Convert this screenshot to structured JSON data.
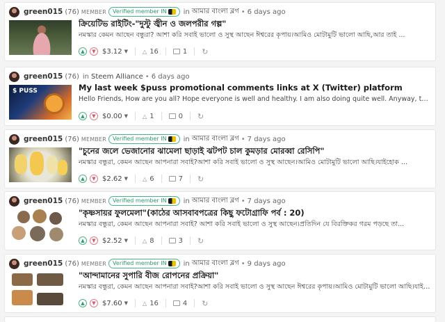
{
  "posts": [
    {
      "author": "green015",
      "reputation": "(76)",
      "member_badge": "MEMBER",
      "verified": "Verified member IN",
      "in_label": "in",
      "community": "আমার বাংলা ব্লগ",
      "separator": "•",
      "time": "6 days ago",
      "title": "ক্রিয়েটিভ রাইটিং-\"দুস্টু জ্বীন ও জলপরীর গল্প\"",
      "snippet": "নমস্কার কেমন আছেন বন্ধুরা? আশা করি সবাই ভালো ও সুস্থ আছেন ঈশ্বরের কৃপায়।আমিও মোটামুটি ভালো আছি,আর তাই ...",
      "payout": "$3.12",
      "votes": "16",
      "comments": "1",
      "thumb": "photo-woman-pink-dress",
      "verified_shown": true
    },
    {
      "author": "green015",
      "reputation": "(76)",
      "member_badge": "",
      "verified": "",
      "in_label": "in",
      "community": "Steem Alliance",
      "separator": "•",
      "time": "6 days ago",
      "title": "My last week $puss promotional comments links at X (Twitter) platform",
      "snippet": "Hello Friends, How are you all? Hope everyone is well and healthy. I am also doing quite well. Anyway, today I am...",
      "payout": "$0.00",
      "votes": "1",
      "comments": "0",
      "thumb": "puss-banner",
      "thumb_label": "$ PUSS",
      "verified_shown": false
    },
    {
      "author": "green015",
      "reputation": "(76)",
      "member_badge": "MEMBER",
      "verified": "Verified member IN",
      "in_label": "in",
      "community": "আমার বাংলা ব্লগ",
      "separator": "•",
      "time": "7 days ago",
      "title": "\"চুনের জলে ভেজানোর ঝামেলা ছাড়াই ঝটপট চাল কুমড়ার মোরব্বা রেসিপি\"",
      "snippet": "নমস্কার বন্ধুরা, কেমন আছেন আপনারা সবাই?আশা করি সবাই ভালো ও সুস্থ আছেন।আমিও মোটামুটি ভালো আছি।যাইহোক ...",
      "payout": "$2.62",
      "votes": "6",
      "comments": "7",
      "thumb": "photo-candied-gourd",
      "verified_shown": true
    },
    {
      "author": "green015",
      "reputation": "(76)",
      "member_badge": "MEMBER",
      "verified": "Verified member IN",
      "in_label": "in",
      "community": "আমার বাংলা ব্লগ",
      "separator": "•",
      "time": "7 days ago",
      "title": "\"কৃষ্ণসায়র ফুলমেলা\"(কাঠের আসবাবপত্রের কিছু ফটোগ্রাফি পর্ব : 20)",
      "snippet": "নমস্কার বন্ধুরা, কেমন আছেন আপনারা সবাই? আশা করি সবাই ভালো ও সুস্থ আছেন।প্রতিদিন যে বিরক্তিকর গরম পড়ছে তা...",
      "payout": "$2.52",
      "votes": "8",
      "comments": "3",
      "thumb": "photo-collage-furniture",
      "verified_shown": true
    },
    {
      "author": "green015",
      "reputation": "(76)",
      "member_badge": "MEMBER",
      "verified": "Verified member IN",
      "in_label": "in",
      "community": "আমার বাংলা ব্লগ",
      "separator": "•",
      "time": "9 days ago",
      "title": "\"আন্দামানের সুপারি বীজ রোপনের প্রক্রিয়া\"",
      "snippet": "নমস্কার বন্ধুরা, কেমন আছেন আপনারা সবাই?আশা করি সবাই ভালো ও সুস্থ আছেন ঈশ্বরের কৃপায়।আমিও মোটামুটি ভালো আছি।যাইহোক ...",
      "payout": "$7.60",
      "votes": "16",
      "comments": "4",
      "thumb": "photo-seed-trays",
      "verified_shown": true
    }
  ],
  "icons": {
    "upvote": "chevron-up-icon",
    "downvote": "chevron-down-icon",
    "payout_caret": "caret-down-icon",
    "votes": "thumbs-up-icon",
    "comments": "comment-icon",
    "reblog": "repost-icon"
  },
  "colors": {
    "upvote": "#2f9a6d",
    "downvote": "#d65a6e",
    "verified": "#2f9a6d"
  }
}
